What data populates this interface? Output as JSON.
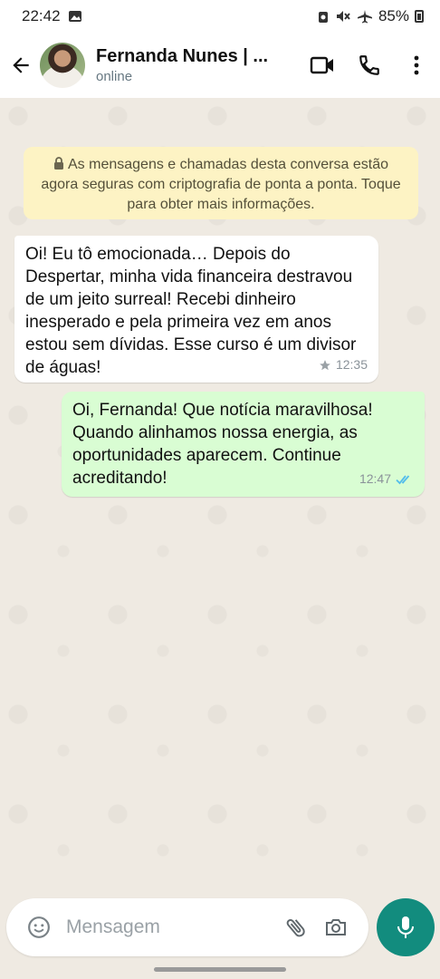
{
  "status_bar": {
    "time": "22:42",
    "battery": "85%"
  },
  "header": {
    "contact_name": "Fernanda Nunes | ...",
    "contact_status": "online"
  },
  "encryption_notice": "As mensagens e chamadas desta conversa estão agora seguras com criptografia de ponta a ponta. Toque para obter mais informações.",
  "messages": [
    {
      "direction": "incoming",
      "text": "Oi! Eu tô emocionada… Depois do Despertar, minha vida financeira destravou de um jeito surreal! Recebi dinheiro inesperado e pela primeira vez em anos estou sem dívidas. Esse curso é um divisor de águas!",
      "time": "12:35",
      "starred": true
    },
    {
      "direction": "outgoing",
      "text": "Oi, Fernanda! Que notícia maravilhosa! Quando alinhamos nossa energia, as oportunidades aparecem. Continue acreditando!",
      "time": "12:47",
      "read": true
    }
  ],
  "composer": {
    "placeholder": "Mensagem"
  },
  "colors": {
    "accent": "#128c7e",
    "outgoing_bubble": "#d9fdd3",
    "read_ticks": "#53bdeb",
    "encryption_bg": "#fdf3c4"
  }
}
